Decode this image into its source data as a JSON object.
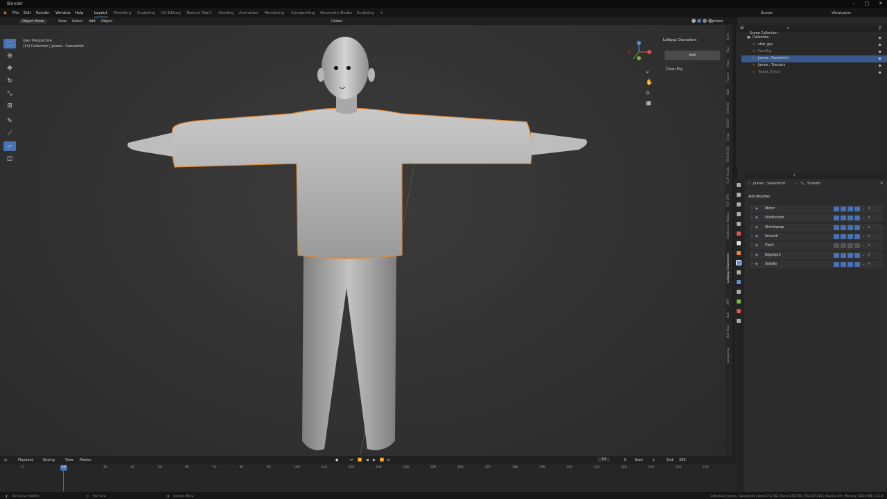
{
  "app": {
    "title": "Blender"
  },
  "menu": {
    "items": [
      "File",
      "Edit",
      "Render",
      "Window",
      "Help"
    ],
    "workspaces": [
      "Layout",
      "Modeling",
      "Sculpting",
      "UV Editing",
      "Texture Paint",
      "Shading",
      "Animation",
      "Rendering",
      "Compositing",
      "Geometry Nodes",
      "Scripting"
    ],
    "active_workspace": "Layout",
    "scene": "Scene",
    "view_layer": "ViewLayer"
  },
  "viewport_header": {
    "mode": "Object Mode",
    "menus": [
      "View",
      "Select",
      "Add",
      "Object"
    ],
    "orientation": "Global",
    "options": "Options"
  },
  "viewport": {
    "perspective": "User Perspective",
    "collection": "(14) Collection | James : Sweatshirt"
  },
  "n_panel": {
    "title": "Lollipop Characters",
    "add_button": "Add",
    "clean_rig": "Clean Rig",
    "tabs": [
      "Item",
      "Tool",
      "View",
      "Fluent",
      "Edit",
      "KHAOS!",
      "FACEIT",
      "Grab",
      "FRACTURE",
      "FLIP Fluids",
      "KIT OPS",
      "Clothes in Motion",
      "Lollipop Characters",
      "ARP",
      "Hair",
      "Hair Tool",
      "polygoniq"
    ]
  },
  "outliner": {
    "root": "Scene Collection",
    "rows": [
      {
        "label": "Collection",
        "selected": false,
        "indent": 1
      },
      {
        "label": "char_grp",
        "selected": false,
        "indent": 2
      },
      {
        "label": "FaceRig",
        "selected": false,
        "indent": 2
      },
      {
        "label": "James : Sweatshirt",
        "selected": true,
        "indent": 2
      },
      {
        "label": "James : Trousers",
        "selected": false,
        "indent": 2
      },
      {
        "label": "Target_Empty",
        "selected": false,
        "indent": 2
      }
    ]
  },
  "properties": {
    "breadcrumb_object": "James : Sweatshirt",
    "breadcrumb_modifier": "Smooth",
    "add_modifier": "Add Modifier",
    "modifiers": [
      {
        "name": "Mirror",
        "icon": "mirror-icon",
        "enabled": true
      },
      {
        "name": "Subdivision",
        "icon": "subdivision-icon",
        "enabled": true
      },
      {
        "name": "Shrinkwrap",
        "icon": "shrinkwrap-icon",
        "enabled": true
      },
      {
        "name": "Smooth",
        "icon": "smooth-icon",
        "enabled": true
      },
      {
        "name": "Cloth",
        "icon": "cloth-icon",
        "enabled": false
      },
      {
        "name": "EdgeSplit",
        "icon": "edgesplit-icon",
        "enabled": true
      },
      {
        "name": "Solidify",
        "icon": "solidify-icon",
        "enabled": true
      }
    ]
  },
  "timeline": {
    "menus": [
      "Playback",
      "Keying",
      "View",
      "Marker"
    ],
    "current_frame": "14",
    "start_label": "Start",
    "start_value": "1",
    "end_label": "End",
    "end_value": "250",
    "ticks": [
      "0",
      "10",
      "20",
      "30",
      "40",
      "50",
      "60",
      "70",
      "80",
      "90",
      "100",
      "110",
      "120",
      "130",
      "140",
      "150",
      "160",
      "170",
      "180",
      "190",
      "200",
      "210",
      "220",
      "230",
      "240",
      "250"
    ]
  },
  "status": {
    "left": "Set Active Modifier",
    "pan": "Pan View",
    "context": "Context Menu",
    "right": "Collection | James : Sweatshirt | Verts:273,782 | Faces:273,794 | Tris:547,516 | Objects:1/9 | Memory: 325.0 MiB | 3.2.0"
  },
  "colors": {
    "accent": "#4772b3",
    "selection_outline": "#e8882b",
    "background": "#323232"
  }
}
